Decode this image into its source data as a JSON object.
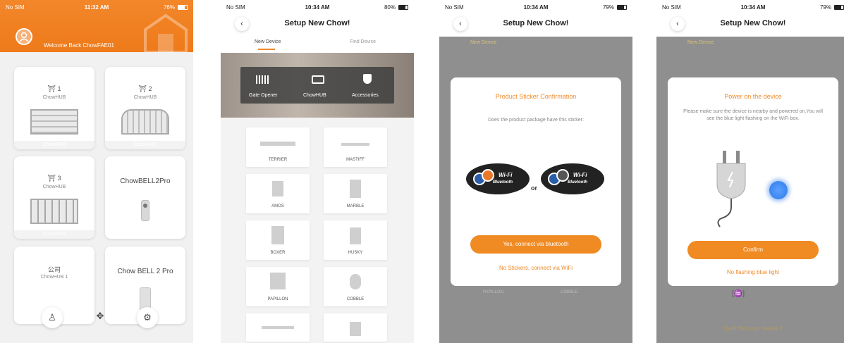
{
  "screen1": {
    "status": {
      "carrier": "No SIM",
      "time": "11:32 AM",
      "battery": "76%"
    },
    "welcome": "Welcome Back ChowFAE01",
    "devices": [
      {
        "num": "1",
        "hub": "ChowHUB",
        "strip": "ChowHUB"
      },
      {
        "num": "2",
        "hub": "ChowHUB",
        "strip": "ChowHUB"
      },
      {
        "num": "3",
        "hub": "ChowHUB",
        "strip": "ChowHUB"
      },
      {
        "title": "ChowBELL2Pro"
      },
      {
        "num": "公司",
        "hub": "ChowHUB 1"
      },
      {
        "title": "Chow BELL 2 Pro"
      }
    ],
    "bottom_icons": [
      "person-icon",
      "add-device-icon",
      "settings-icon"
    ]
  },
  "screen2": {
    "status": {
      "carrier": "No SIM",
      "time": "10:34 AM",
      "battery": "80%"
    },
    "title": "Setup New Chow!",
    "tabs": [
      "New Device",
      "Find Device"
    ],
    "categories": [
      "Gate Opener",
      "ChowHUB",
      "Accessories"
    ],
    "devices": [
      "TERRIER",
      "MASTIFF",
      "AMOS",
      "MARBLE",
      "BOXER",
      "HUSKY",
      "PAPILLON",
      "COBBLE"
    ]
  },
  "screen3": {
    "status": {
      "carrier": "No SIM",
      "time": "10:34 AM",
      "battery": "79%"
    },
    "title": "Setup New Chow!",
    "tab": "New Device",
    "dialog": {
      "title": "Product Sticker Confirmation",
      "text": "Does the product package have this sticker:",
      "sticker_wifi": "Wi-Fi",
      "sticker_bt": "Bluetooth",
      "or": "or",
      "confirm": "Yes, connect via bluetooth",
      "alt": "No Stickers, connect via WiFi"
    },
    "bg_labels": [
      "PAPILLON",
      "COBBLE"
    ]
  },
  "screen4": {
    "status": {
      "carrier": "No SIM",
      "time": "10:34 AM",
      "battery": "79%"
    },
    "title": "Setup New Chow!",
    "tab": "New Device",
    "dialog": {
      "title": "Power on the device",
      "text": "Please make sure the device is nearby and powered on.You will see the blue light flashing on the WiFi box.",
      "confirm": "Confirm",
      "alt": "No flashing blue light"
    },
    "bottom_link": "Can't find your device ?"
  },
  "colors": {
    "accent": "#f08a2a",
    "dim": "#8f8f8f",
    "blue_light": "#2f7be8"
  }
}
